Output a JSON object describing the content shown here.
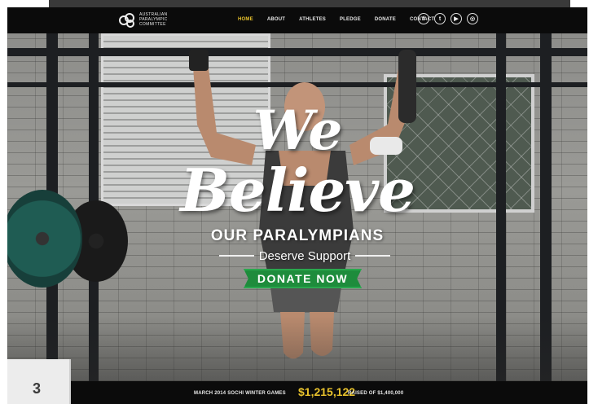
{
  "header": {
    "logo_text": "AUSTRALIAN PARALYMPIC COMMITTEE",
    "nav": [
      {
        "label": "HOME",
        "active": true
      },
      {
        "label": "ABOUT",
        "active": false
      },
      {
        "label": "ATHLETES",
        "active": false
      },
      {
        "label": "PLEDGE",
        "active": false
      },
      {
        "label": "DONATE",
        "active": false
      },
      {
        "label": "CONTACT",
        "active": false
      }
    ],
    "social": [
      {
        "name": "facebook-icon",
        "glyph": "f"
      },
      {
        "name": "twitter-icon",
        "glyph": "t"
      },
      {
        "name": "youtube-icon",
        "glyph": "▶"
      },
      {
        "name": "instagram-icon",
        "glyph": "◎"
      }
    ]
  },
  "hero": {
    "line1": "We",
    "line2": "Believe",
    "line3": "OUR PARALYMPIANS",
    "line4": "Deserve Support",
    "cta": "DONATE NOW"
  },
  "footer": {
    "label": "MARCH 2014 SOCHI WINTER GAMES",
    "amount": "$1,215,122",
    "target": "RAISED OF $1,400,000"
  },
  "podium": {
    "number": "3"
  },
  "colors": {
    "accent": "#e8c22c",
    "cta": "#1e8c3c",
    "bar": "#0b0b0b"
  }
}
